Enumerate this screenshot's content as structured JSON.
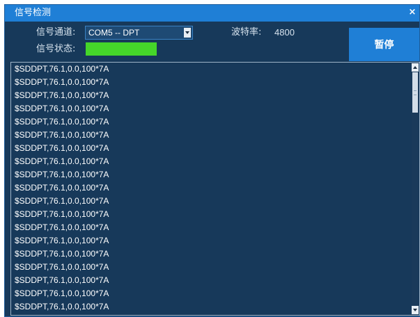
{
  "window": {
    "title": "信号检测",
    "close_glyph": "×"
  },
  "form": {
    "channel_label": "信号通道:",
    "channel_value": "COM5 -- DPT",
    "status_label": "信号状态:",
    "status_color": "#45d62a",
    "baud_label": "波特率:",
    "baud_value": "4800"
  },
  "pause_button": {
    "label": "暂停"
  },
  "log": {
    "lines": [
      "$SDDPT,76.1,0.0,100*7A",
      "$SDDPT,76.1,0.0,100*7A",
      "$SDDPT,76.1,0.0,100*7A",
      "$SDDPT,76.1,0.0,100*7A",
      "$SDDPT,76.1,0.0,100*7A",
      "$SDDPT,76.1,0.0,100*7A",
      "$SDDPT,76.1,0.0,100*7A",
      "$SDDPT,76.1,0.0,100*7A",
      "$SDDPT,76.1,0.0,100*7A",
      "$SDDPT,76.1,0.0,100*7A",
      "$SDDPT,76.1,0.0,100*7A",
      "$SDDPT,76.1,0.0,100*7A",
      "$SDDPT,76.1,0.0,100*7A",
      "$SDDPT,76.1,0.0,100*7A",
      "$SDDPT,76.1,0.0,100*7A",
      "$SDDPT,76.1,0.0,100*7A",
      "$SDDPT,76.1,0.0,100*7A",
      "$SDDPT,76.1,0.0,100*7A",
      "$SDDPT,76.1,0.0,100*7A"
    ]
  }
}
